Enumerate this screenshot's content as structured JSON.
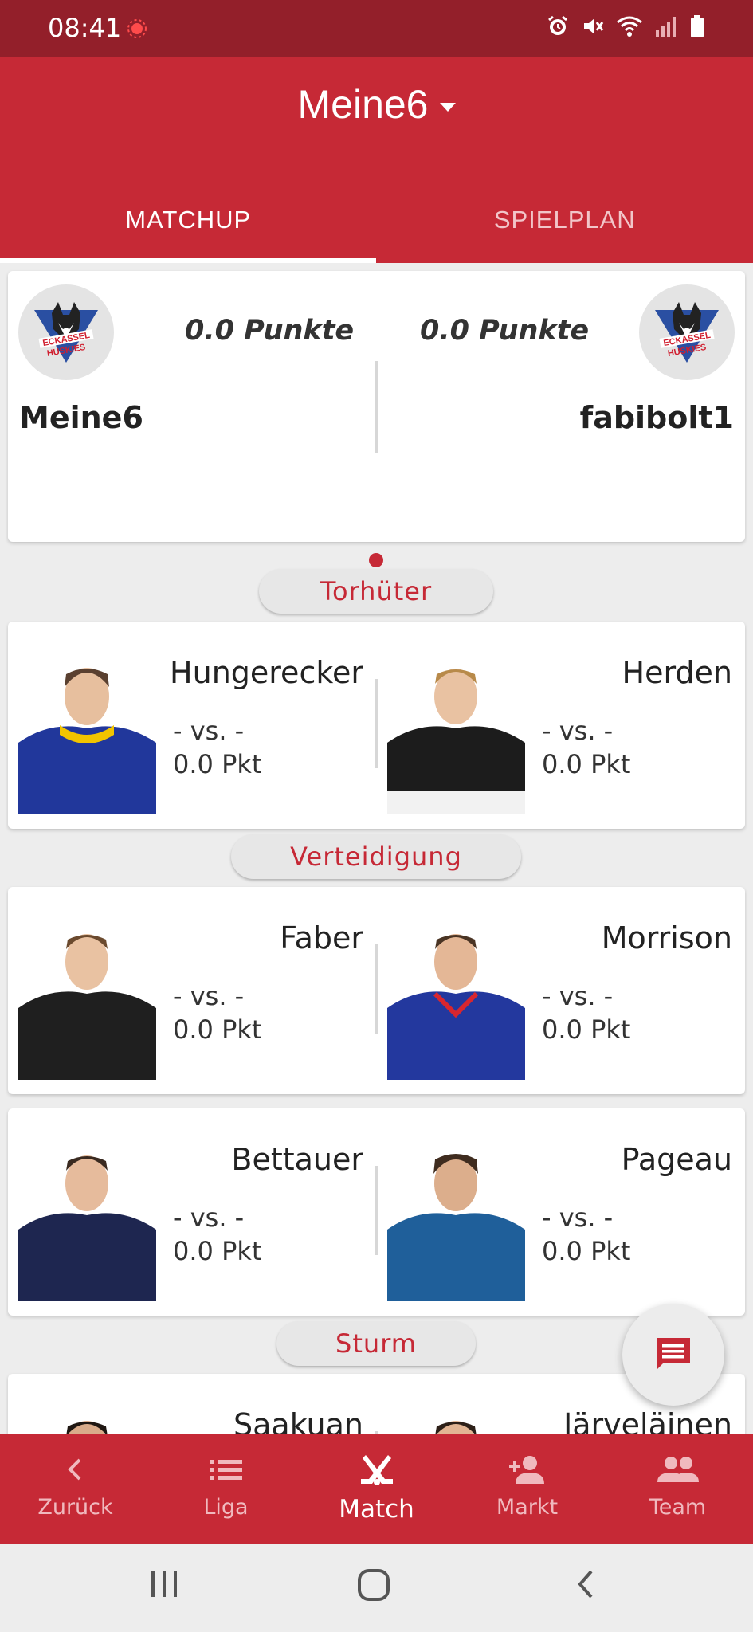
{
  "status_bar": {
    "time": "08:41",
    "icons": [
      "recording-icon",
      "alarm-icon",
      "mute-icon",
      "wifi-icon",
      "signal-icon",
      "battery-icon"
    ]
  },
  "header": {
    "title": "Meine6",
    "tabs": [
      {
        "label": "MATCHUP",
        "active": true
      },
      {
        "label": "SPIELPLAN",
        "active": false
      }
    ]
  },
  "matchup": {
    "left": {
      "team": "Meine6",
      "points": "0.0 Punkte",
      "logo": "ec-kassel-huskies-logo"
    },
    "right": {
      "team": "fabibolt1",
      "points": "0.0 Punkte",
      "logo": "ec-kassel-huskies-logo"
    }
  },
  "sections": {
    "goalie": "Torhüter",
    "defense": "Verteidigung",
    "forward": "Sturm"
  },
  "rows": [
    {
      "left": {
        "name": "Hungerecker",
        "vs": "- vs. -",
        "pkt": "0.0 Pkt"
      },
      "right": {
        "name": "Herden",
        "vs": "- vs. -",
        "pkt": "0.0 Pkt"
      }
    },
    {
      "left": {
        "name": "Faber",
        "vs": "- vs. -",
        "pkt": "0.0 Pkt"
      },
      "right": {
        "name": "Morrison",
        "vs": "- vs. -",
        "pkt": "0.0 Pkt"
      }
    },
    {
      "left": {
        "name": "Bettauer",
        "vs": "- vs. -",
        "pkt": "0.0 Pkt"
      },
      "right": {
        "name": "Pageau",
        "vs": "- vs. -",
        "pkt": "0.0 Pkt"
      }
    },
    {
      "left": {
        "name": "Saakuan"
      },
      "right": {
        "name": "Järveläinen"
      }
    }
  ],
  "bottom_nav": [
    {
      "label": "Zurück",
      "icon": "chevron-left-icon"
    },
    {
      "label": "Liga",
      "icon": "list-icon"
    },
    {
      "label": "Match",
      "icon": "hockey-sticks-icon",
      "active": true
    },
    {
      "label": "Markt",
      "icon": "person-add-icon"
    },
    {
      "label": "Team",
      "icon": "group-icon"
    }
  ],
  "colors": {
    "primary": "#c62936",
    "status_bar": "#931f2a",
    "background": "#ededed"
  }
}
